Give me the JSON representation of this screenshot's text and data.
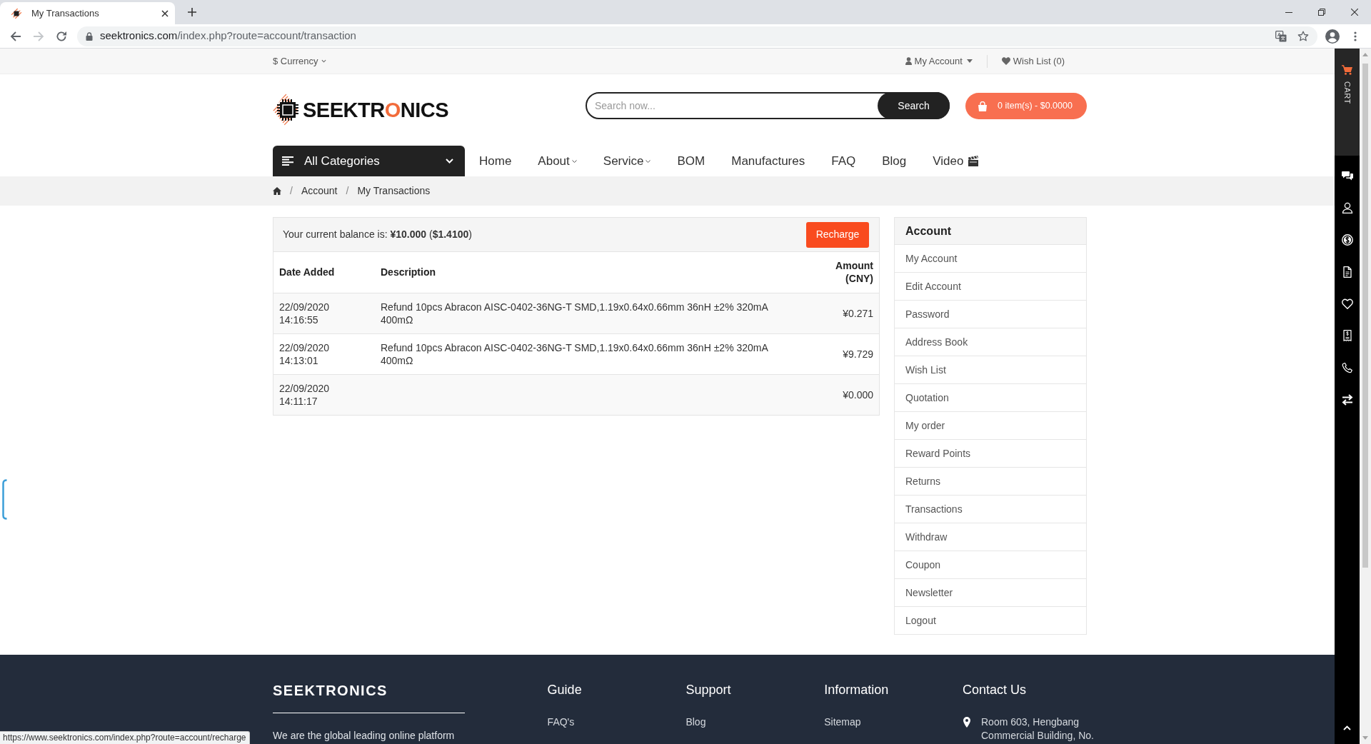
{
  "browser": {
    "tab_title": "My Transactions",
    "url_host": "seektronics.com",
    "url_path": "/index.php?route=account/transaction",
    "forward_disabled": true
  },
  "top_bar": {
    "currency": "$ Currency",
    "account": "My Account",
    "wish_list": "Wish List (0)"
  },
  "header": {
    "logo": [
      {
        "text": "SEEKTR",
        "accent": false
      },
      {
        "text": "O",
        "accent": true
      },
      {
        "text": "NICS",
        "accent": false
      }
    ],
    "search": {
      "placeholder": "Search now...",
      "button": "Search"
    },
    "cart": "0 item(s) - $0.0000"
  },
  "nav": {
    "categories": "All Categories",
    "items": [
      {
        "label": "Home",
        "kind": "link"
      },
      {
        "label": "About",
        "kind": "dropdown"
      },
      {
        "label": "Service",
        "kind": "dropdown"
      },
      {
        "label": "BOM",
        "kind": "link"
      },
      {
        "label": "Manufactures",
        "kind": "link"
      },
      {
        "label": "FAQ",
        "kind": "link"
      },
      {
        "label": "Blog",
        "kind": "link"
      },
      {
        "label": "Video",
        "kind": "media"
      }
    ]
  },
  "breadcrumb": {
    "separator": "/",
    "items": [
      "Account",
      "My Transactions"
    ]
  },
  "balance": {
    "text": "Your current balance is: **¥10.000** (**$1.4100**)",
    "button": "Recharge"
  },
  "table": {
    "columns": [
      "Date Added",
      "Description",
      "Amount (CNY)"
    ],
    "rows": [
      {
        "date": "22/09/2020 14:16:55",
        "description": "Refund 10pcs Abracon AISC-0402-36NG-T SMD,1.19x0.64x0.66mm 36nH ±2% 320mA 400mΩ",
        "amount": "¥0.271"
      },
      {
        "date": "22/09/2020 14:13:01",
        "description": "Refund 10pcs Abracon AISC-0402-36NG-T SMD,1.19x0.64x0.66mm 36nH ±2% 320mA 400mΩ",
        "amount": "¥9.729"
      },
      {
        "date": "22/09/2020 14:11:17",
        "amount": "¥0.000"
      }
    ]
  },
  "sidebar": {
    "title": "Account",
    "items": [
      "My Account",
      "Edit Account",
      "Password",
      "Address Book",
      "Wish List",
      "Quotation",
      "My order",
      "Reward Points",
      "Returns",
      "Transactions",
      "Withdraw",
      "Coupon",
      "Newsletter",
      "Logout"
    ]
  },
  "side_dock": {
    "cart_label": "CART"
  },
  "footer": {
    "brand": "SEEKTRONICS",
    "about": "We are the global leading online platform",
    "columns": [
      {
        "kind": "links",
        "title": "Guide",
        "links": [
          "FAQ's"
        ]
      },
      {
        "kind": "links",
        "title": "Support",
        "links": [
          "Blog"
        ]
      },
      {
        "kind": "links",
        "title": "Information",
        "links": [
          "Sitemap"
        ]
      },
      {
        "kind": "contact",
        "title": "Contact Us",
        "address": "Room 603, Hengbang Commercial Building, No."
      }
    ]
  },
  "status_bar": {
    "url": "https://www.seektronics.com/index.php?route=account/recharge"
  }
}
